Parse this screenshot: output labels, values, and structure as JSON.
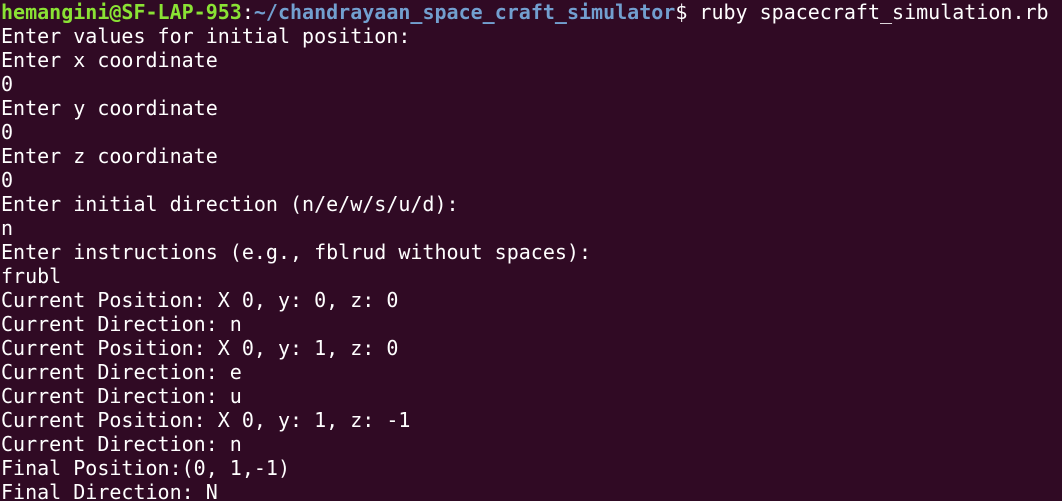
{
  "prompt": {
    "user_host": "hemangini@SF-LAP-953",
    "separator": ":",
    "path": "~/chandrayaan_space_craft_simulator",
    "dollar": "$",
    "command": " ruby spacecraft_simulation.rb"
  },
  "output_lines": [
    "Enter values for initial position:",
    "Enter x coordinate",
    "0",
    "Enter y coordinate",
    "0",
    "Enter z coordinate",
    "0",
    "Enter initial direction (n/e/w/s/u/d):",
    "n",
    "Enter instructions (e.g., fblrud without spaces):",
    "frubl",
    "Current Position: X 0, y: 0, z: 0",
    "Current Direction: n",
    "Current Position: X 0, y: 1, z: 0",
    "Current Direction: e",
    "Current Direction: u",
    "Current Position: X 0, y: 1, z: -1",
    "Current Direction: n",
    "Final Position:(0, 1,-1)",
    "Final Direction: N"
  ],
  "colors": {
    "background": "#300a24",
    "user_host": "#8ae234",
    "path": "#729fcf",
    "text": "#ffffff"
  }
}
